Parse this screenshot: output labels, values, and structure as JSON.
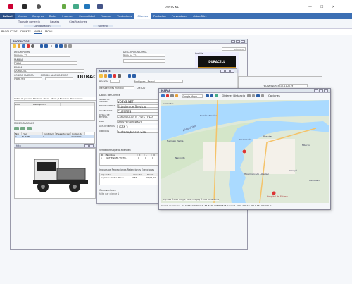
{
  "titlebar": {
    "title": "VOSYS.NET",
    "min": "—",
    "max": "☐",
    "close": "✕"
  },
  "menu": {
    "tabs": [
      "Relixel",
      "Ventas",
      "Compras",
      "Datos",
      "Informes",
      "Contabilidad",
      "Finanzas",
      "Vendedores",
      "Clientes",
      "Productos",
      "Proveedores",
      "ribbonTab1"
    ],
    "active": "Clientes",
    "submenu": [
      "Tipos de comercio",
      "Canales",
      "Clasificaciones"
    ],
    "submenu2": [
      "Configuración",
      "General"
    ],
    "doc_tabs": [
      "PRODUCTOS",
      "CLIENTE",
      "MAPAS",
      "MOVIL"
    ]
  },
  "productos": {
    "title": "PRODUCTOS",
    "search_placeholder": "Búsqueda",
    "page": "1",
    "desc_label": "DESCRIPCION",
    "desc_value": "PILA AA X2",
    "desc_corta_label": "DESCRIPCION CORTA",
    "desc_corta_value": "PILA AA X2",
    "familia_label": "FAMILIA",
    "familia_value": "PILAS",
    "marca_label": "MARCA",
    "marca_value": "DURACELL",
    "codigo_label": "CODIGO FABRICA",
    "codigo_value": "7898765",
    "alfa_label": "CODIGO ALFANUMERICO",
    "brand": "DURACE",
    "subtabs": [
      "Listas de precios",
      "Medidas",
      "Pesos",
      "Stock / Ubicacion",
      "Descuentos"
    ],
    "lista_cols": [
      "Lista",
      "Descripcion"
    ],
    "presentaciones": "PRESENTACIONES",
    "pres_cols": [
      "Nro",
      "Tipo",
      "Cantidad",
      "Presentacion",
      "Codigo de"
    ],
    "pres_row": [
      "1",
      "BLISTER",
      "1",
      "",
      "2047-000"
    ],
    "logo_text": "DURACELL",
    "bastilla": "bastilla",
    "foto_label": "foto"
  },
  "cliente": {
    "title": "CLIENTE",
    "cuit_label": "REGION",
    "cuit_value": "1",
    "razon": "Rodriguez - Rafael",
    "grupo_value": "Perspectivas Mundial",
    "cuit2": "CUIT:20",
    "fecha_label": "FECHA/INGRESO",
    "fecha_value": "15.11.2019",
    "datos_label": "Datos de Cliente",
    "nombre_label": "NOMBRE DE FANTASIA",
    "nombre_value": "VOSYS.NET",
    "tipo_label": "TIPO DE COMERCIO",
    "tipo_value": "Estacion de Servicio",
    "clasif_label": "CLASIFICACION",
    "clasif_value": "CLIENTES",
    "detalle_label": "DETALLE DE ENTREGA",
    "detalle_value": "Entregar en la casa (DEP",
    "zona_label": "ZONA",
    "zona_value": "PROCYDAPURARI",
    "lista_label": "LISTA DE PRECIOS",
    "lista_value": "LISTA 3",
    "cond_label": "CONDICION",
    "cond_value": "contado/tarjeta visa",
    "vendedor_label": "Vendedores que lo atienden",
    "vend_cols": [
      "ID",
      "Nombre",
      "D",
      "L",
      "M"
    ],
    "vend_row": [
      "1",
      "MATTENGER VICTO...",
      "0",
      "0",
      "0"
    ],
    "imp_label": "Impuestos Percepciones Retenciones Exenciones",
    "imp_cols": [
      "Impuesto",
      "Alicuota",
      "Desde"
    ],
    "imp_row": [
      "Ingresos Brutos Rtnes",
      "3,5%",
      "01/01/20"
    ],
    "obs_label": "Observaciones",
    "obs_value": "falta dar cliente 1"
  },
  "mapas": {
    "title": "MAPAS",
    "dropdown": "Google Mapa",
    "obtener": "Obtener Distancia",
    "opciones": "Opciones",
    "footer": "Coord. decimales: -27.373681957962  S  -55.8748 WIN829575  0   Coord. GPS:  27° 22' 21\"  S  55° 54' 33\"  O",
    "copyright": "Map data ©2022 Google, INEGI, Imagery ©2022 TerraMetrics",
    "places": [
      "Corrientes",
      "Posadas",
      "Encarnación",
      "Garupá",
      "Candelaria",
      "Mbarika",
      "Hospital de Fátima",
      "Hipermercado Libertad",
      "Naranjito",
      "Nemesio Parma",
      "Ramón Vizcaíno",
      "ARGENTINA"
    ]
  },
  "colors": {
    "accent": "#2b5fa8",
    "menubar": "#3c6fb4",
    "map_water": "#aadaff",
    "map_land": "#e8eee4"
  }
}
